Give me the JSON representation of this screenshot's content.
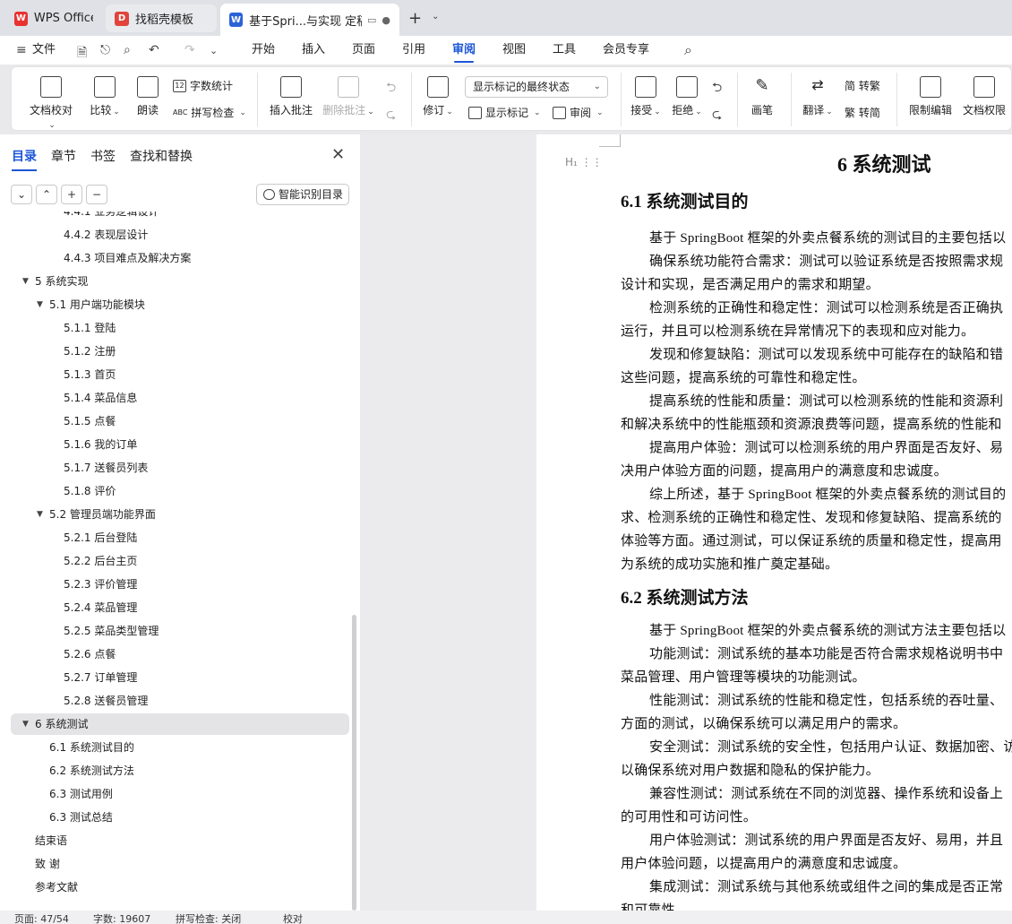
{
  "tabs": [
    {
      "label": "WPS Office",
      "icon": "wps-logo-icon"
    },
    {
      "label": "找稻壳模板",
      "icon": "docer-logo-icon"
    },
    {
      "label": "基于Spri...与实现 定稿",
      "icon": "word-doc-icon",
      "active": true
    }
  ],
  "menu": {
    "file": "文件",
    "items": [
      "开始",
      "插入",
      "页面",
      "引用",
      "审阅",
      "视图",
      "工具",
      "会员专享"
    ],
    "active": "审阅"
  },
  "ribbon": {
    "doc_check": "文档校对",
    "compare": "比较",
    "read_aloud": "朗读",
    "word_count": "字数统计",
    "spell_check": "拼写检查",
    "insert_comment": "插入批注",
    "delete_comment": "删除批注",
    "track_changes": "修订",
    "markup_state": "显示标记的最终状态",
    "show_markup": "显示标记",
    "review": "审阅",
    "accept": "接受",
    "reject": "拒绝",
    "pen": "画笔",
    "translate": "翻译",
    "to_traditional": "简 转繁",
    "to_simplified": "繁 转简",
    "restrict_edit": "限制编辑",
    "doc_permission": "文档权限"
  },
  "nav": {
    "tabs": [
      "目录",
      "章节",
      "书签",
      "查找和替换"
    ],
    "active_tab": "目录",
    "smart_button": "智能识别目录",
    "toc": [
      {
        "text": "4.4.1 业务逻辑设计",
        "level": 3
      },
      {
        "text": "4.4.2 表现层设计",
        "level": 3
      },
      {
        "text": "4.4.3 项目难点及解决方案",
        "level": 3
      },
      {
        "text": "5  系统实现",
        "level": 1,
        "expanded": true
      },
      {
        "text": "5.1 用户端功能模块",
        "level": 2,
        "expanded": true
      },
      {
        "text": "5.1.1  登陆",
        "level": 3
      },
      {
        "text": "5.1.2 注册",
        "level": 3
      },
      {
        "text": "5.1.3 首页",
        "level": 3
      },
      {
        "text": "5.1.4 菜品信息",
        "level": 3
      },
      {
        "text": "5.1.5 点餐",
        "level": 3
      },
      {
        "text": "5.1.6 我的订单",
        "level": 3
      },
      {
        "text": "5.1.7 送餐员列表",
        "level": 3
      },
      {
        "text": "5.1.8 评价",
        "level": 3
      },
      {
        "text": "5.2 管理员端功能界面",
        "level": 2,
        "expanded": true
      },
      {
        "text": "5.2.1  后台登陆",
        "level": 3
      },
      {
        "text": "5.2.2  后台主页",
        "level": 3
      },
      {
        "text": "5.2.3 评价管理",
        "level": 3
      },
      {
        "text": "5.2.4 菜品管理",
        "level": 3
      },
      {
        "text": "5.2.5 菜品类型管理",
        "level": 3
      },
      {
        "text": "5.2.6 点餐",
        "level": 3
      },
      {
        "text": "5.2.7 订单管理",
        "level": 3
      },
      {
        "text": "5.2.8 送餐员管理",
        "level": 3
      },
      {
        "text": "6  系统测试",
        "level": 1,
        "expanded": true,
        "selected": true
      },
      {
        "text": "6.1 系统测试目的",
        "level": 2
      },
      {
        "text": "6.2 系统测试方法",
        "level": 2
      },
      {
        "text": "6.3 测试用例",
        "level": 2
      },
      {
        "text": "6.3 测试总结",
        "level": 2
      },
      {
        "text": "结束语",
        "level": 1
      },
      {
        "text": "致   谢",
        "level": 1
      },
      {
        "text": "参考文献",
        "level": 1
      }
    ]
  },
  "document": {
    "heading1": "6  系统测试",
    "section1_title": "6.1 系统测试目的",
    "section1_lines": [
      {
        "text": "基于 SpringBoot 框架的外卖点餐系统的测试目的主要包括以",
        "indent": true
      },
      {
        "text": "确保系统功能符合需求：测试可以验证系统是否按照需求规",
        "indent": true
      },
      {
        "text": "设计和实现，是否满足用户的需求和期望。",
        "indent": false
      },
      {
        "text": "检测系统的正确性和稳定性：测试可以检测系统是否正确执",
        "indent": true
      },
      {
        "text": "运行，并且可以检测系统在异常情况下的表现和应对能力。",
        "indent": false
      },
      {
        "text": "发现和修复缺陷：测试可以发现系统中可能存在的缺陷和错",
        "indent": true
      },
      {
        "text": "这些问题，提高系统的可靠性和稳定性。",
        "indent": false
      },
      {
        "text": "提高系统的性能和质量：测试可以检测系统的性能和资源利",
        "indent": true
      },
      {
        "text": "和解决系统中的性能瓶颈和资源浪费等问题，提高系统的性能和",
        "indent": false
      },
      {
        "text": "提高用户体验：测试可以检测系统的用户界面是否友好、易",
        "indent": true
      },
      {
        "text": "决用户体验方面的问题，提高用户的满意度和忠诚度。",
        "indent": false
      },
      {
        "text": "综上所述，基于 SpringBoot 框架的外卖点餐系统的测试目的",
        "indent": true
      },
      {
        "text": "求、检测系统的正确性和稳定性、发现和修复缺陷、提高系统的",
        "indent": false
      },
      {
        "text": "体验等方面。通过测试，可以保证系统的质量和稳定性，提高用",
        "indent": false
      },
      {
        "text": "为系统的成功实施和推广奠定基础。",
        "indent": false
      }
    ],
    "section2_title": "6.2 系统测试方法",
    "section2_lines": [
      {
        "text": "基于 SpringBoot 框架的外卖点餐系统的测试方法主要包括以",
        "indent": true
      },
      {
        "text": "功能测试：测试系统的基本功能是否符合需求规格说明书中",
        "indent": true
      },
      {
        "text": "菜品管理、用户管理等模块的功能测试。",
        "indent": false
      },
      {
        "text": "性能测试：测试系统的性能和稳定性，包括系统的吞吐量、",
        "indent": true
      },
      {
        "text": "方面的测试，以确保系统可以满足用户的需求。",
        "indent": false
      },
      {
        "text": "安全测试：测试系统的安全性，包括用户认证、数据加密、访",
        "indent": true
      },
      {
        "text": "以确保系统对用户数据和隐私的保护能力。",
        "indent": false
      },
      {
        "text": "兼容性测试：测试系统在不同的浏览器、操作系统和设备上",
        "indent": true
      },
      {
        "text": "的可用性和可访问性。",
        "indent": false
      },
      {
        "text": "用户体验测试：测试系统的用户界面是否友好、易用，并且",
        "indent": true
      },
      {
        "text": "用户体验问题，以提高用户的满意度和忠诚度。",
        "indent": false
      },
      {
        "text": "集成测试：测试系统与其他系统或组件之间的集成是否正常",
        "indent": true
      },
      {
        "text": "和可靠性",
        "indent": false
      }
    ]
  },
  "status": {
    "page": "页面: 47/54",
    "words": "字数: 19607",
    "spell": "拼写检查: 关闭",
    "proof": "校对"
  }
}
